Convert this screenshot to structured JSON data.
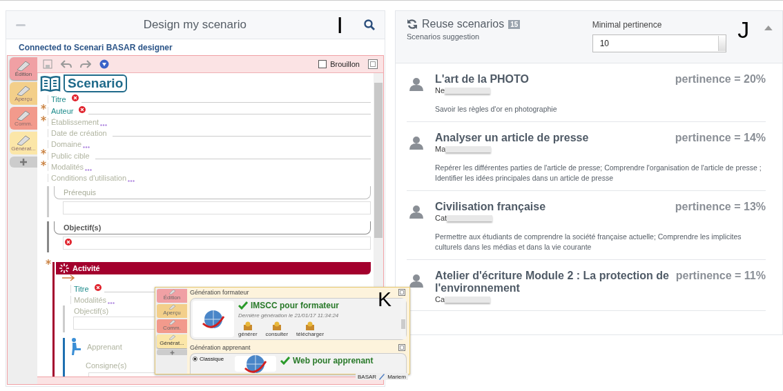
{
  "annotations": [
    "I",
    "J",
    "K"
  ],
  "designer": {
    "title": "Design my scenario",
    "connection": "Connected to Scenari BASAR designer",
    "side_tabs": [
      {
        "label": "Édition",
        "selected": true,
        "color": "#f0a0a4"
      },
      {
        "label": "Aperçu",
        "selected": false,
        "color": "#f3cf8a"
      },
      {
        "label": "Comm.",
        "selected": false,
        "color": "#f29a8c"
      },
      {
        "label": "Générat...",
        "selected": false,
        "color": "#fbe6a8"
      }
    ],
    "draft": {
      "label": "Brouillon",
      "checked": false
    },
    "scenario_label": "Scenario",
    "fields": [
      {
        "label": "Titre",
        "kind": "line",
        "required": false,
        "error": true
      },
      {
        "label": "Auteur",
        "kind": "line",
        "required": true,
        "error": true
      },
      {
        "label": "Établissement",
        "kind": "ellipsis",
        "required": true,
        "error": false
      },
      {
        "label": "Date de création",
        "kind": "line",
        "required": false,
        "error": false
      },
      {
        "label": "Domaine",
        "kind": "ellipsis",
        "required": false,
        "error": false
      },
      {
        "label": "Public cible",
        "kind": "line",
        "required": true,
        "error": false
      },
      {
        "label": "Modalités",
        "kind": "ellipsis",
        "required": true,
        "error": false
      },
      {
        "label": "Conditions d'utilisation",
        "kind": "ellipsis",
        "required": false,
        "error": false
      }
    ],
    "blocks": [
      {
        "title": "Prérequis",
        "required": false,
        "error": false
      },
      {
        "title": "Objectif(s)",
        "required": true,
        "error": true
      }
    ],
    "activity": {
      "title": "Activité",
      "fields": [
        {
          "label": "Titre",
          "kind": "line",
          "required": false,
          "error": true
        },
        {
          "label": "Modalités",
          "kind": "ellipsis",
          "required": false,
          "error": false
        }
      ],
      "objective": "Objectif(s)",
      "learner": "Apprenant",
      "instructions": "Consigne(s)"
    },
    "popup": {
      "side_tabs": [
        {
          "label": "Édition",
          "selected": false,
          "color": "#f0a0a4"
        },
        {
          "label": "Aperçu",
          "selected": false,
          "color": "#f3cf8a"
        },
        {
          "label": "Comm.",
          "selected": false,
          "color": "#f29a8c"
        },
        {
          "label": "Générat...",
          "selected": true,
          "color": "#fbe6a8"
        }
      ],
      "sections": [
        {
          "title": "Génération formateur",
          "heading": "IMSCC pour formateur",
          "note": "Dernière génération le 21/01/17 11:34:24",
          "actions": [
            "générer",
            "consulter",
            "télécharger"
          ]
        },
        {
          "title": "Génération apprenant",
          "heading": "Web pour apprenant",
          "options": [
            {
              "label": "Classique",
              "selected": true
            }
          ]
        }
      ],
      "status": [
        "BASAR",
        "Mariem"
      ]
    }
  },
  "reuse": {
    "title": "Reuse scenarios",
    "count": "15",
    "subtitle": "Scenarios suggestion",
    "filter_label": "Minimal pertinence",
    "filter_value": "10",
    "results": [
      {
        "title": "L'art de la PHOTO",
        "author": "Ne",
        "pertinence": "pertinence = 20%",
        "description": "Savoir les règles d'or en photographie"
      },
      {
        "title": "Analyser un article de presse",
        "author": "Ma",
        "pertinence": "pertinence = 14%",
        "description": "Repérer les différentes parties de l'article de presse; Comprendre l'organisation de l'article de presse ; Identifier les idées principales dans un article de presse"
      },
      {
        "title": "Civilisation française",
        "author": "Cat",
        "pertinence": "pertinence = 13%",
        "description": "Permettre aux étudiants de comprendre la société française actuelle; Comprendre les implicites culturels dans les médias et dans la vie courante"
      },
      {
        "title": "Atelier d'écriture Module 2 : La protection de l'environnement",
        "author": "Ca",
        "pertinence": "pertinence = 11%"
      }
    ]
  }
}
